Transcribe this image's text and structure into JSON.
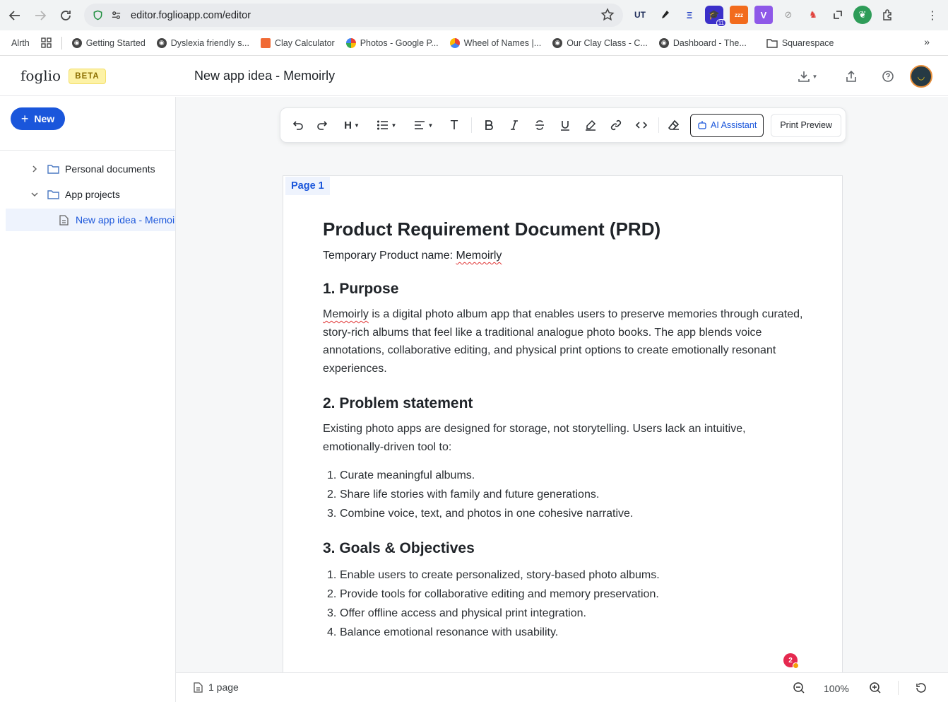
{
  "browser": {
    "url": "editor.foglioapp.com/editor",
    "bookmarks": [
      {
        "label": "Alrth"
      },
      {
        "label": "Getting Started"
      },
      {
        "label": "Dyslexia friendly s..."
      },
      {
        "label": "Clay Calculator"
      },
      {
        "label": "Photos - Google P..."
      },
      {
        "label": "Wheel of Names |..."
      },
      {
        "label": "Our Clay Class - C..."
      },
      {
        "label": "Dashboard - The..."
      },
      {
        "label": "Squarespace"
      }
    ],
    "extension_badge": "11"
  },
  "app": {
    "logo": "foglio",
    "badge": "BETA",
    "doc_title": "New app idea - Memoirly"
  },
  "sidebar": {
    "new_label": "New",
    "items": [
      {
        "label": "Personal documents"
      },
      {
        "label": "App projects"
      },
      {
        "label": "New app idea - Memoirly"
      }
    ]
  },
  "toolbar": {
    "heading_label": "H",
    "text_label": "T",
    "ai_label": "AI Assistant",
    "print_label": "Print Preview"
  },
  "page": {
    "tag": "Page 1",
    "title": "Product Requirement Document (PRD)",
    "name_prefix": "Temporary Product name: ",
    "name_value": "Memoirly",
    "purpose_heading": "1. Purpose",
    "purpose_word": "Memoirly",
    "purpose_text": " is a digital photo album app that enables users to preserve memories through curated, story-rich albums that feel like a traditional analogue photo books. The app blends voice annotations, collaborative editing, and physical print options to create emotionally resonant experiences.",
    "problem_heading": "2. Problem statement",
    "problem_text": "Existing photo apps are designed for storage, not storytelling. Users lack an intuitive, emotionally-driven tool to:",
    "problem_list": [
      {
        "num": "1.",
        "text": "Curate meaningful albums."
      },
      {
        "num": "2.",
        "text": "Share life stories with family and future generations."
      },
      {
        "num": "3.",
        "text": "Combine voice, text, and photos in one cohesive narrative."
      }
    ],
    "goals_heading": "3. Goals & Objectives",
    "goals_list": [
      {
        "num": "1.",
        "text": "Enable users to create personalized, story-based photo albums."
      },
      {
        "num": "2.",
        "text": "Provide tools for collaborative editing and memory preservation."
      },
      {
        "num": "3.",
        "text": "Offer offline access and physical print integration."
      },
      {
        "num": "4.",
        "text": "Balance emotional resonance with usability."
      }
    ]
  },
  "notification_count": "2",
  "footer": {
    "pages": "1 page",
    "zoom": "100%"
  }
}
